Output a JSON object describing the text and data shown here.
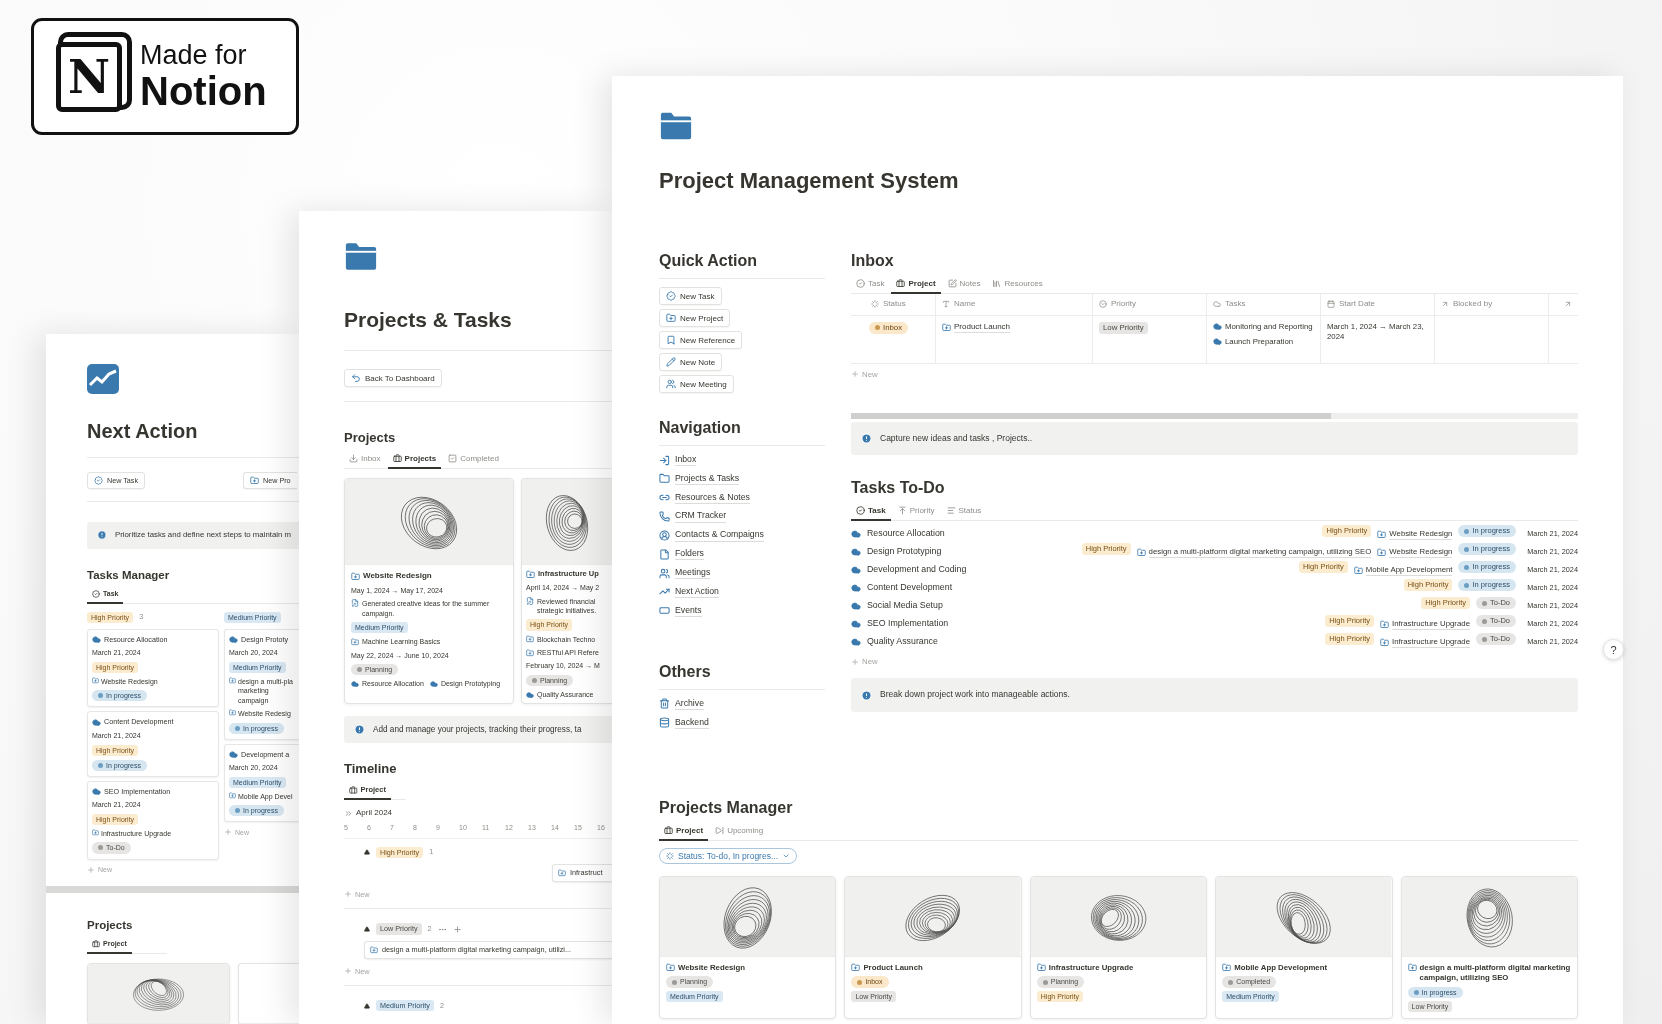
{
  "badge": {
    "logo_letter": "N",
    "line1": "Made for",
    "line2": "Notion"
  },
  "next_action_page": {
    "title": "Next Action",
    "buttons": [
      "New Task",
      "New Pro"
    ],
    "callout": "Prioritize tasks and define next steps to maintain m",
    "tasks_manager": {
      "title": "Tasks Manager",
      "tabs": [
        {
          "label": "Task",
          "selected": true
        }
      ],
      "columns": [
        {
          "label": "High Priority",
          "kind": "high",
          "count": "3",
          "new_label": "New",
          "cards": [
            {
              "title": "Resource Allocation",
              "date": "March 21, 2024",
              "priority": {
                "label": "High Priority",
                "kind": "high"
              },
              "projects": [
                "Website Redesign"
              ],
              "status": {
                "label": "In progress",
                "kind": "in_progress"
              }
            },
            {
              "title": "Content Development",
              "date": "March 21, 2024",
              "priority": {
                "label": "High Priority",
                "kind": "high"
              },
              "status": {
                "label": "In progress",
                "kind": "in_progress"
              }
            },
            {
              "title": "SEO Implementation",
              "date": "March 21, 2024",
              "priority": {
                "label": "High Priority",
                "kind": "high"
              },
              "projects": [
                "Infrastructure Upgrade"
              ],
              "status": {
                "label": "To-Do",
                "kind": "todo"
              }
            }
          ]
        },
        {
          "label": "Medium Priority",
          "kind": "medium",
          "new_label": "New",
          "cards": [
            {
              "title": "Design Prototy",
              "date": "March 20, 2024",
              "priority": {
                "label": "Medium Priority",
                "kind": "medium"
              },
              "projects": [
                "design a multi-pla\nmarketing campaign",
                "Website Redesig"
              ],
              "status": {
                "label": "In progress",
                "kind": "in_progress"
              }
            },
            {
              "title": "Development a",
              "date": "March 20, 2024",
              "priority": {
                "label": "Medium Priority",
                "kind": "medium"
              },
              "projects": [
                "Mobile App Devel"
              ],
              "status": {
                "label": "In progress",
                "kind": "in_progress"
              }
            }
          ]
        }
      ]
    },
    "projects": {
      "title": "Projects",
      "tabs": [
        {
          "label": "Project",
          "selected": true
        }
      ]
    }
  },
  "projects_tasks_page": {
    "title": "Projects & Tasks",
    "back_button": "Back To Dashboard",
    "projects": {
      "title": "Projects",
      "tabs": [
        {
          "label": "Inbox",
          "selected": false
        },
        {
          "label": "Projects",
          "selected": true
        },
        {
          "label": "Completed",
          "selected": false
        }
      ],
      "cards": [
        {
          "title": "Website Redesign",
          "date": "May 1, 2024 → May 17, 2024",
          "note": "Generated creative ideas for the summer campaign.",
          "priority": {
            "label": "Medium Priority",
            "kind": "medium"
          },
          "projects": [
            "Machine Learning Basics"
          ],
          "date_2": "May 22, 2024 → June 10, 2024",
          "status": {
            "label": "Planning",
            "kind": "planning"
          },
          "tasks": [
            "Resource Allocation",
            "Design Prototyping"
          ]
        },
        {
          "title": "Infrastructure Up",
          "date": "April 14, 2024 → May 2",
          "note": "Reviewed financial\nstrategic initiatives.",
          "priority": {
            "label": "High Priority",
            "kind": "high"
          },
          "projects": [
            "Blockchain Techno",
            "RESTful API Refere"
          ],
          "date_2": "February 10, 2024 → M",
          "status": {
            "label": "Planning",
            "kind": "planning"
          },
          "tasks": [
            "Quality Assurance"
          ]
        }
      ]
    },
    "callout": "Add and manage your projects, tracking their progress, ta",
    "timeline": {
      "title": "Timeline",
      "tabs": [
        {
          "label": "Project",
          "selected": true
        }
      ],
      "month": "April 2024",
      "days": [
        "5",
        "6",
        "7",
        "8",
        "9",
        "10",
        "11",
        "12",
        "13",
        "14",
        "15",
        "16"
      ],
      "groups": [
        {
          "label": "High Priority",
          "kind": "high",
          "count": "1",
          "actions": false,
          "bars": [
            "Infrastruct"
          ],
          "new_label": "New"
        },
        {
          "label": "Low Priority",
          "kind": "low",
          "count": "2",
          "actions": true,
          "bars": [
            "design a multi-platform digital marketing campaign, utilizi..."
          ],
          "new_label": "New"
        },
        {
          "label": "Medium Priority",
          "kind": "medium",
          "count": "2",
          "actions": false
        }
      ]
    }
  },
  "main_page": {
    "title": "Project Management System",
    "quick_action": {
      "title": "Quick Action",
      "buttons": [
        "New Task",
        "New Project",
        "New Reference",
        "New Note",
        "New Meeting"
      ]
    },
    "navigation": {
      "title": "Navigation",
      "links": [
        "Inbox",
        "Projects & Tasks",
        "Resources & Notes",
        "CRM Tracker",
        "Contacts & Compaigns",
        "Folders",
        "Meetings",
        "Next Action",
        "Events"
      ]
    },
    "others": {
      "title": "Others",
      "links": [
        "Archive",
        "Backend"
      ]
    },
    "inbox": {
      "title": "Inbox",
      "tabs": [
        {
          "label": "Task",
          "selected": false
        },
        {
          "label": "Project",
          "selected": true
        },
        {
          "label": "Notes",
          "selected": false
        },
        {
          "label": "Resources",
          "selected": false
        }
      ],
      "columns": [
        "Status",
        "Name",
        "Priority",
        "Tasks",
        "Start Date",
        "Blocked by"
      ],
      "rows": [
        {
          "status": {
            "label": "Inbox",
            "kind": "inbox"
          },
          "name": "Product Launch",
          "priority": {
            "label": "Low Priority",
            "kind": "low"
          },
          "tasks": [
            "Monitoring and Reporting",
            "Launch Preparation"
          ],
          "start_date": "March 1, 2024 → March 23, 2024"
        }
      ],
      "new_label": "New",
      "callout": "Capture new ideas and tasks , Projects.."
    },
    "tasks_todo": {
      "title": "Tasks To-Do",
      "tabs": [
        {
          "label": "Task",
          "selected": true
        },
        {
          "label": "Priority",
          "selected": false
        },
        {
          "label": "Status",
          "selected": false
        }
      ],
      "rows": [
        {
          "name": "Resource Allocation",
          "priority": {
            "label": "High Priority",
            "kind": "high"
          },
          "projects": [
            "Website Redesign"
          ],
          "status": {
            "label": "In progress",
            "kind": "in_progress"
          },
          "date": "March 21, 2024"
        },
        {
          "name": "Design Prototyping",
          "priority": {
            "label": "High Priority",
            "kind": "high"
          },
          "projects": [
            "design a multi-platform digital marketing campaign, utilizing SEO",
            "Website Redesign"
          ],
          "status": {
            "label": "In progress",
            "kind": "in_progress"
          },
          "date": "March 21, 2024"
        },
        {
          "name": "Development and Coding",
          "priority": {
            "label": "High Priority",
            "kind": "high"
          },
          "projects": [
            "Mobile App Development"
          ],
          "status": {
            "label": "In progress",
            "kind": "in_progress"
          },
          "date": "March 21, 2024"
        },
        {
          "name": "Content Development",
          "priority": {
            "label": "High Priority",
            "kind": "high"
          },
          "status": {
            "label": "In progress",
            "kind": "in_progress"
          },
          "date": "March 21, 2024"
        },
        {
          "name": "Social Media Setup",
          "priority": {
            "label": "High Priority",
            "kind": "high"
          },
          "status": {
            "label": "To-Do",
            "kind": "todo"
          },
          "date": "March 21, 2024"
        },
        {
          "name": "SEO Implementation",
          "priority": {
            "label": "High Priority",
            "kind": "high"
          },
          "projects": [
            "Infrastructure Upgrade"
          ],
          "status": {
            "label": "To-Do",
            "kind": "todo"
          },
          "date": "March 21, 2024"
        },
        {
          "name": "Quality Assurance",
          "priority": {
            "label": "High Priority",
            "kind": "high"
          },
          "projects": [
            "Infrastructure Upgrade"
          ],
          "status": {
            "label": "To-Do",
            "kind": "todo"
          },
          "date": "March 21, 2024"
        }
      ],
      "new_label": "New",
      "callout": "Break down project work into manageable actions."
    },
    "projects_manager": {
      "title": "Projects Manager",
      "tabs": [
        {
          "label": "Project",
          "selected": true
        },
        {
          "label": "Upcoming",
          "selected": false
        }
      ],
      "filter": "Status: To-do, In progres...",
      "cards": [
        {
          "title": "Website Redesign",
          "status": {
            "label": "Planning",
            "kind": "planning"
          },
          "priority": {
            "label": "Medium Priority",
            "kind": "medium"
          }
        },
        {
          "title": "Product Launch",
          "status": {
            "label": "Inbox",
            "kind": "inbox"
          },
          "priority": {
            "label": "Low Priority",
            "kind": "low"
          }
        },
        {
          "title": "Infrastructure Upgrade",
          "status": {
            "label": "Planning",
            "kind": "planning"
          },
          "priority": {
            "label": "High Priority",
            "kind": "high"
          }
        },
        {
          "title": "Mobile App Development",
          "status": {
            "label": "Completed",
            "kind": "completed"
          },
          "priority": {
            "label": "Medium Priority",
            "kind": "medium"
          }
        },
        {
          "title": "design a multi-platform digital marketing campaign, utilizing SEO",
          "status": {
            "label": "In progress",
            "kind": "in_progress"
          },
          "priority": {
            "label": "Low Priority",
            "kind": "low"
          }
        }
      ]
    },
    "help_button": "?"
  }
}
